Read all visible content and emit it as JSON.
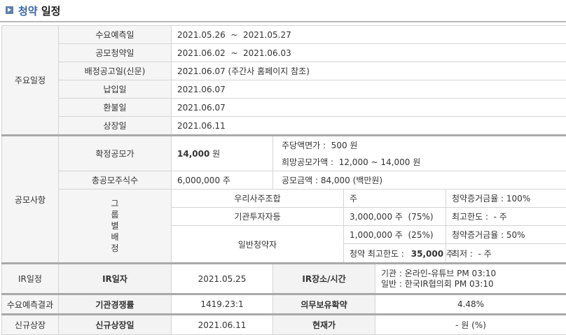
{
  "header": {
    "title_accent": "청약",
    "title_rest": "일정"
  },
  "schedule": {
    "category": "주요일정",
    "rows": [
      {
        "label": "수요예측일",
        "value": "2021.05.26  ~  2021.05.27"
      },
      {
        "label": "공모청약일",
        "value": "2021.06.02  ~  2021.06.03"
      },
      {
        "label": "배정공고일(신문)",
        "value": "2021.06.07 (주간사 홈페이지 참조)"
      },
      {
        "label": "납입일",
        "value": "2021.06.07"
      },
      {
        "label": "환불일",
        "value": "2021.06.07"
      },
      {
        "label": "상장일",
        "value": "2021.06.11"
      }
    ]
  },
  "offering": {
    "category": "공모사항",
    "confirmed_price_label": "확정공모가",
    "confirmed_price_value": "14,000",
    "confirmed_price_unit": "원",
    "par_value": "주당액면가 :  500 원",
    "hope_price": "희망공모가액 :  12,000 ~ 14,000 원",
    "total_shares_label": "총공모주식수",
    "total_shares_value": "6,000,000 주",
    "total_amount": "공모금액 : 84,000 (백만원)",
    "group_label_chars": [
      "그",
      "룹",
      "별",
      "배",
      "정"
    ],
    "employee_label": "우리사주조합",
    "employee_shares": "주",
    "employee_deposit": "청약증거금율 : 100%",
    "institution_label": "기관투자자등",
    "institution_shares": "3,000,000 주  (75%)",
    "institution_limit": "최고한도 :  - 주",
    "general_label": "일반청약자",
    "general_shares": "1,000,000 주  (25%)",
    "general_deposit": "청약증거금율 : 50%",
    "general_max_prefix": "청약 최고한도 :",
    "general_max_value": "35,000",
    "general_max_unit": "주",
    "general_min": "최저 :  - 주"
  },
  "ir": {
    "category": "IR일정",
    "date_label": "IR일자",
    "date_value": "2021.05.25",
    "place_label": "IR장소/시간",
    "place_line1": "기관 : 온라인-유튜브 PM 03:10",
    "place_line2": "일반 : 한국IR협의회 PM 03:10"
  },
  "demand": {
    "category": "수요예측결과",
    "competition_label": "기관경쟁률",
    "competition_value": "1419.23:1",
    "lockup_label": "의무보유확약",
    "lockup_value": "4.48%"
  },
  "listing": {
    "category": "신규상장",
    "date_label": "신규상장일",
    "date_value": "2021.06.11",
    "price_label": "현재가",
    "price_value": "- 원 (%)"
  }
}
